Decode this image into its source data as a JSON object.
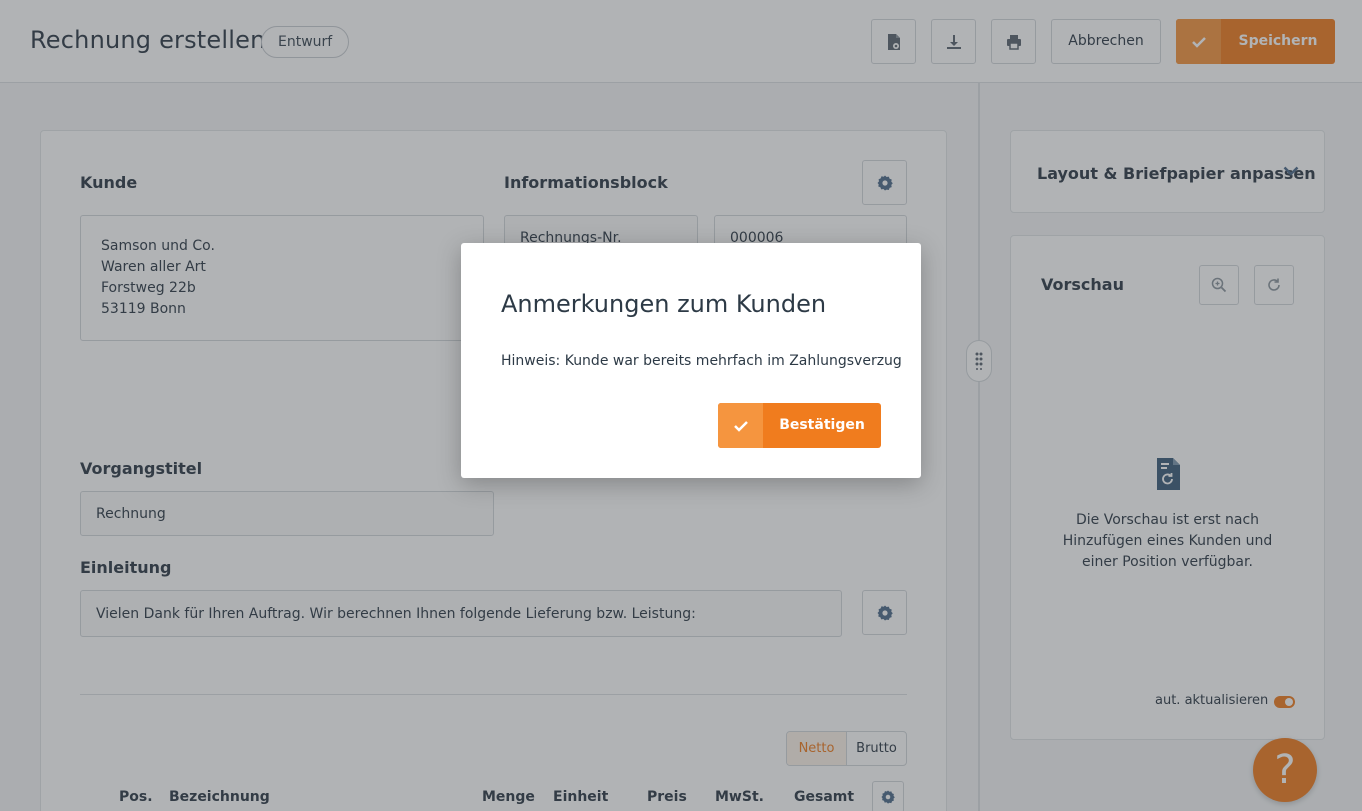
{
  "header": {
    "title": "Rechnung erstellen",
    "status_badge": "Entwurf",
    "cancel_label": "Abbrechen",
    "save_label": "Speichern",
    "icons": [
      "document-settings-icon",
      "download-icon",
      "print-icon"
    ]
  },
  "customer": {
    "label": "Kunde",
    "address_lines": [
      "Samson und Co.",
      "Waren aller Art",
      "Forstweg 22b",
      "53119 Bonn"
    ]
  },
  "info_block": {
    "label": "Informationsblock",
    "invoice_number_label": "Rechnungs-Nr.",
    "invoice_number_value": "000006"
  },
  "title_section": {
    "label": "Vorgangstitel",
    "value": "Rechnung"
  },
  "intro_section": {
    "label": "Einleitung",
    "value": "Vielen Dank für Ihren Auftrag. Wir berechnen Ihnen folgende Lieferung bzw. Leistung:"
  },
  "price_mode": {
    "options": [
      "Netto",
      "Brutto"
    ],
    "selected": "Netto"
  },
  "table": {
    "columns": [
      "Pos.",
      "Bezeichnung",
      "Menge",
      "Einheit",
      "Preis",
      "MwSt.",
      "Gesamt"
    ]
  },
  "sidebar": {
    "layout_title": "Layout & Briefpapier anpassen",
    "preview_title": "Vorschau",
    "preview_message": "Die Vorschau ist erst nach Hinzufügen eines Kunden und einer Position verfügbar.",
    "auto_update_label": "aut. aktualisieren",
    "auto_update_on": true
  },
  "help": {
    "label": "?"
  },
  "modal": {
    "title": "Anmerkungen zum Kunden",
    "message": "Hinweis: Kunde war bereits mehrfach im Zahlungsverzug",
    "confirm_label": "Bestätigen"
  },
  "colors": {
    "accent": "#f07c1e",
    "accent_light": "#f5953f",
    "text": "#2d3a46",
    "border": "#d3d7db"
  }
}
